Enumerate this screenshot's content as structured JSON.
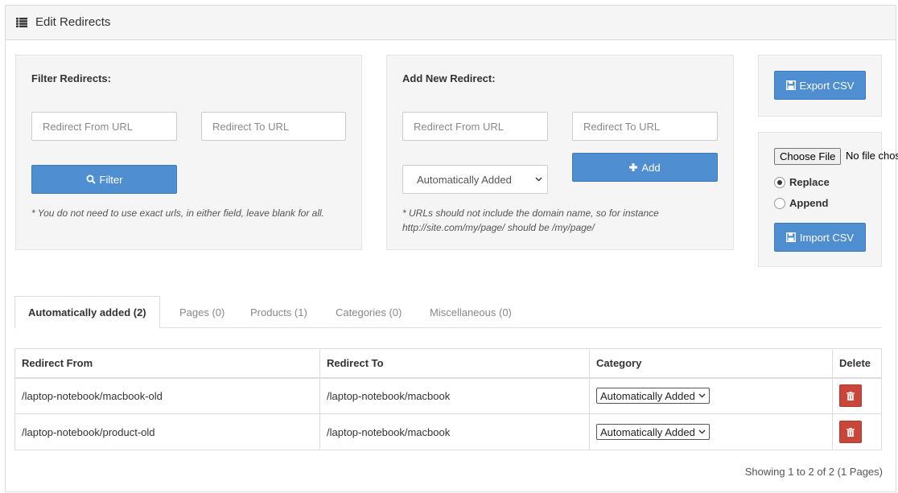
{
  "header": {
    "title": "Edit Redirects",
    "icon": "list-icon"
  },
  "filter": {
    "title": "Filter Redirects:",
    "from_placeholder": "Redirect From URL",
    "to_placeholder": "Redirect To URL",
    "button_label": "Filter",
    "note": "* You do not need to use exact urls, in either field, leave blank for all."
  },
  "add": {
    "title": "Add New Redirect:",
    "from_placeholder": "Redirect From URL",
    "to_placeholder": "Redirect To URL",
    "category_selected": "Automatically Added",
    "button_label": "Add",
    "note": "* URLs should not include the domain name, so for instance http://site.com/my/page/ should be /my/page/"
  },
  "export": {
    "button_label": "Export CSV"
  },
  "import": {
    "file_button": "Choose File",
    "file_status": "No file chosen",
    "options": [
      {
        "label": "Replace",
        "checked": true
      },
      {
        "label": "Append",
        "checked": false
      }
    ],
    "button_label": "Import CSV"
  },
  "tabs": [
    {
      "label": "Automatically added (2)",
      "active": true
    },
    {
      "label": "Pages (0)",
      "active": false
    },
    {
      "label": "Products (1)",
      "active": false
    },
    {
      "label": "Categories (0)",
      "active": false
    },
    {
      "label": "Miscellaneous (0)",
      "active": false
    }
  ],
  "table": {
    "columns": [
      "Redirect From",
      "Redirect To",
      "Category",
      "Delete"
    ],
    "rows": [
      {
        "from": "/laptop-notebook/macbook-old",
        "to": "/laptop-notebook/macbook",
        "category": "Automatically Added"
      },
      {
        "from": "/laptop-notebook/product-old",
        "to": "/laptop-notebook/macbook",
        "category": "Automatically Added"
      }
    ]
  },
  "pagination": {
    "info": "Showing 1 to 2 of 2 (1 Pages)"
  },
  "colors": {
    "primary": "#4f8ed1",
    "danger": "#c9473a",
    "well": "#f5f5f5"
  }
}
